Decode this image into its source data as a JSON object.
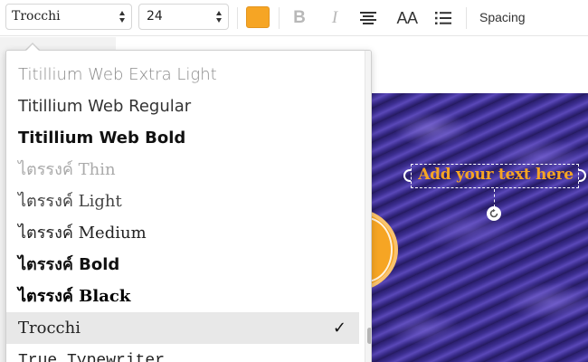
{
  "toolbar": {
    "font_value": "Trocchi",
    "size_value": "24",
    "color": "#f6a524",
    "bold_label": "B",
    "italic_label": "I",
    "caps_label": "AA",
    "spacing_label": "Spacing"
  },
  "canvas": {
    "text": "Add your text here",
    "text_color": "#f6a524",
    "accent_circle_color": "#f6a524"
  },
  "font_list": {
    "items": [
      {
        "label": "Titillium Web Extra Light",
        "style": "extra-light"
      },
      {
        "label": "Titillium Web Regular",
        "style": "regular"
      },
      {
        "label": "Titillium Web Bold",
        "style": "bold"
      },
      {
        "label": "ไตรรงค์ Thin",
        "style": "thin"
      },
      {
        "label": "ไตรรงค์ Light",
        "style": "light"
      },
      {
        "label": "ไตรรงค์ Medium",
        "style": "medium"
      },
      {
        "label": "ไตรรงค์ Bold",
        "style": "bold"
      },
      {
        "label": "ไตรรงค์ Black",
        "style": "black"
      },
      {
        "label": "Trocchi",
        "style": "serif",
        "selected": true,
        "check": "✓"
      },
      {
        "label": "True Typewriter",
        "style": "mono"
      }
    ]
  }
}
